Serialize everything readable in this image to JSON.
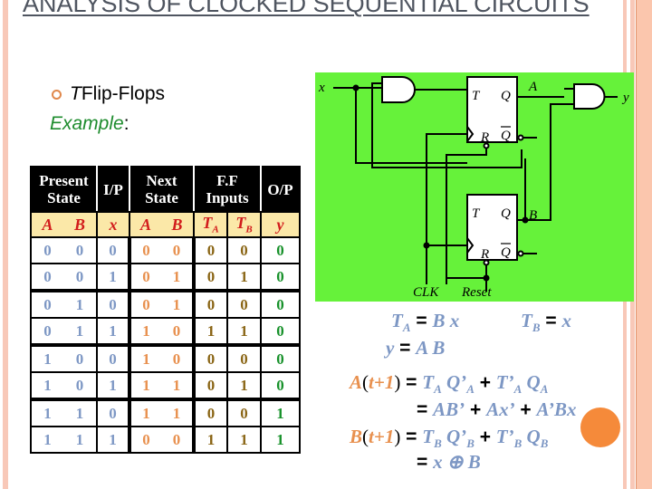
{
  "title": "ANALYSIS OF CLOCKED SEQUENTIAL CIRCUITS",
  "bullet": {
    "italic_part": "T",
    "text": " Flip-Flops"
  },
  "example": {
    "label": "Example",
    "colon": ":"
  },
  "table": {
    "headers": [
      {
        "label": "Present State",
        "colspan": 2
      },
      {
        "label": "I/P",
        "colspan": 1
      },
      {
        "label": "Next State",
        "colspan": 2
      },
      {
        "label": "F.F Inputs",
        "colspan": 2
      },
      {
        "label": "O/P",
        "colspan": 1
      }
    ],
    "subheaders": [
      "A",
      "B",
      "x",
      "A",
      "B",
      "T_A",
      "T_B",
      "y"
    ],
    "rows": [
      [
        0,
        0,
        0,
        0,
        0,
        0,
        0,
        0
      ],
      [
        0,
        0,
        1,
        0,
        1,
        0,
        1,
        0
      ],
      [
        0,
        1,
        0,
        0,
        1,
        0,
        0,
        0
      ],
      [
        0,
        1,
        1,
        1,
        0,
        1,
        1,
        0
      ],
      [
        1,
        0,
        0,
        1,
        0,
        0,
        0,
        0
      ],
      [
        1,
        0,
        1,
        1,
        1,
        0,
        1,
        0
      ],
      [
        1,
        1,
        0,
        1,
        1,
        0,
        0,
        1
      ],
      [
        1,
        1,
        1,
        0,
        0,
        1,
        1,
        1
      ]
    ]
  },
  "circuit": {
    "labels": {
      "input": "x",
      "output": "y",
      "ffA_out": "A",
      "ffB_out": "B",
      "clk": "CLK",
      "reset": "Reset",
      "t": "T",
      "q": "Q",
      "qbar": "Q",
      "r": "R"
    },
    "background": "#66f23a"
  },
  "equations": {
    "ta": {
      "lhs": "T",
      "sub": "A",
      "rhs": "B x"
    },
    "tb": {
      "lhs": "T",
      "sub": "B",
      "rhs": "x"
    },
    "y": {
      "lhs": "y",
      "rhs": "A B"
    },
    "a_next": {
      "lhs": "A",
      "t": "t+1",
      "line1": "T_A Q'_A + T'_A Q_A",
      "line2": "AB' + Ax' + A'Bx"
    },
    "b_next": {
      "lhs": "B",
      "t": "t+1",
      "line1": "T_B Q'_B + T'_B Q_B",
      "line2": "x ⊕ B"
    }
  },
  "colors": {
    "title": "#4f5560",
    "accent_orange": "#f58a3a",
    "present": "#7d97c4",
    "next": "#e8904e",
    "ff": "#8a6515",
    "out": "#17912a",
    "subheader_bg": "#fbe8a8",
    "subheader_text": "#d21c1c"
  }
}
